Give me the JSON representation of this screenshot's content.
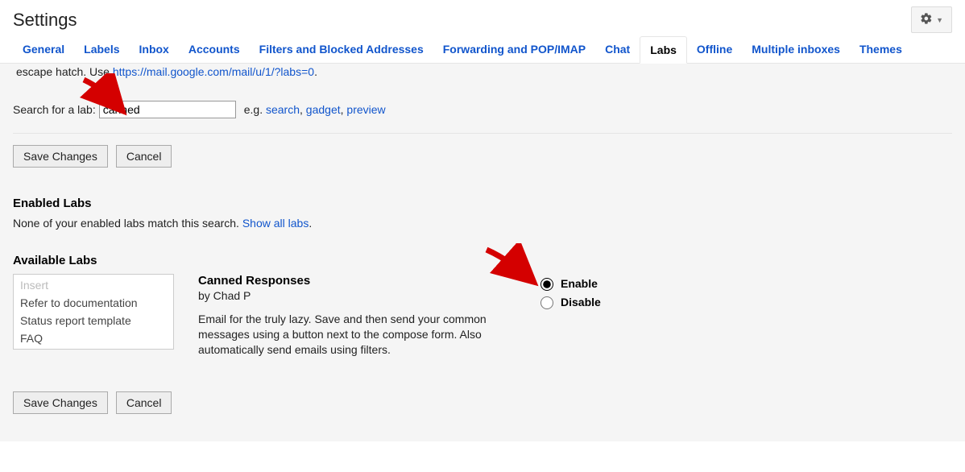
{
  "header": {
    "title": "Settings"
  },
  "tabs": [
    {
      "label": "General",
      "active": false
    },
    {
      "label": "Labels",
      "active": false
    },
    {
      "label": "Inbox",
      "active": false
    },
    {
      "label": "Accounts",
      "active": false
    },
    {
      "label": "Filters and Blocked Addresses",
      "active": false
    },
    {
      "label": "Forwarding and POP/IMAP",
      "active": false
    },
    {
      "label": "Chat",
      "active": false
    },
    {
      "label": "Labs",
      "active": true
    },
    {
      "label": "Offline",
      "active": false
    },
    {
      "label": "Multiple inboxes",
      "active": false
    },
    {
      "label": "Themes",
      "active": false
    }
  ],
  "escape": {
    "prefix": "escape hatch. Use ",
    "link": "https://mail.google.com/mail/u/1/?labs=0",
    "suffix": "."
  },
  "search": {
    "label": "Search for a lab:",
    "value": "canned",
    "eg_prefix": "e.g. ",
    "eg_links": [
      "search",
      "gadget",
      "preview"
    ]
  },
  "buttons": {
    "save": "Save Changes",
    "cancel": "Cancel"
  },
  "enabled": {
    "heading": "Enabled Labs",
    "msg_prefix": "None of your enabled labs match this search. ",
    "show_all": "Show all labs",
    "msg_suffix": "."
  },
  "available": {
    "heading": "Available Labs",
    "templates": [
      {
        "label": "Insert",
        "placeholder": true
      },
      {
        "label": "Refer to documentation",
        "placeholder": false
      },
      {
        "label": "Status report template",
        "placeholder": false
      },
      {
        "label": "FAQ",
        "placeholder": false
      }
    ],
    "lab": {
      "title": "Canned Responses",
      "author": "by Chad P",
      "body": "Email for the truly lazy. Save and then send your common messages using a button next to the compose form. Also automatically send emails using filters."
    },
    "radios": {
      "enable": "Enable",
      "disable": "Disable",
      "selected": "enable"
    }
  }
}
